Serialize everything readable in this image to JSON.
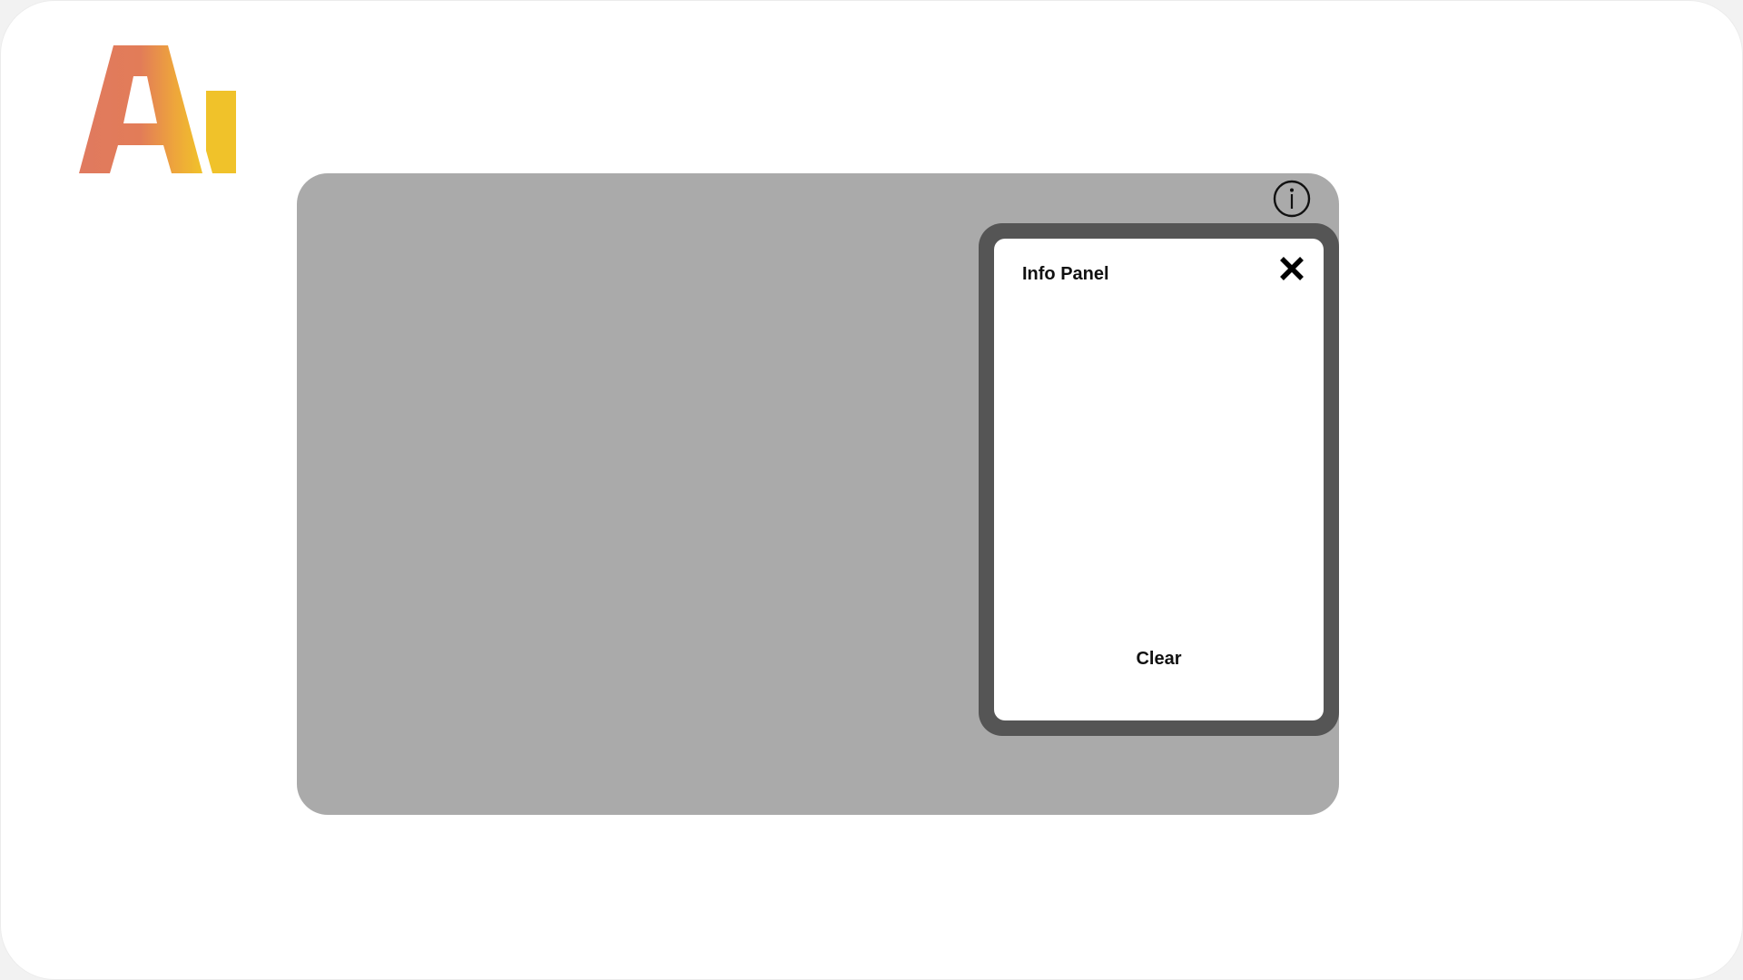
{
  "logo": {
    "icon": "ai-logo",
    "gradient_colors": [
      "#e07a5f",
      "#f0c22a"
    ]
  },
  "main_panel": {
    "background_color": "#aaaaaa",
    "info_button_icon": "info-circle-icon"
  },
  "info_panel": {
    "title": "Info Panel",
    "close_icon": "close-icon",
    "clear_label": "Clear",
    "border_color": "#555555"
  }
}
